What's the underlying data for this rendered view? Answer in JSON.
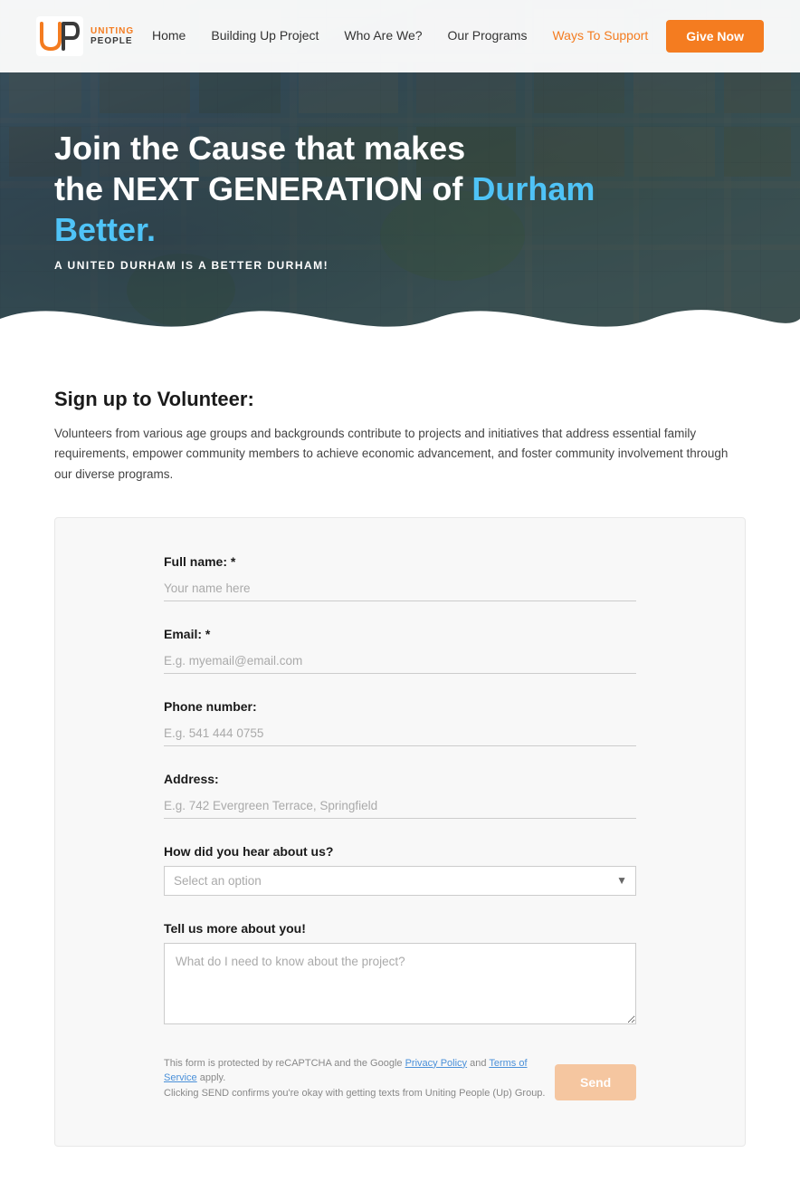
{
  "nav": {
    "logo_text": "UNITING PEOPLE",
    "links": [
      {
        "label": "Home",
        "active": false
      },
      {
        "label": "Building Up Project",
        "active": false
      },
      {
        "label": "Who Are We?",
        "active": false
      },
      {
        "label": "Our Programs",
        "active": false
      },
      {
        "label": "Ways To Support",
        "active": true
      }
    ],
    "cta_label": "Give Now"
  },
  "hero": {
    "title_line1": "Join the Cause that makes",
    "title_line2_plain": "the NEXT GENERATION of",
    "title_line2_highlight": "Durham Better.",
    "subtitle": "A United Durham is a Better Durham!"
  },
  "section": {
    "title": "Sign up to Volunteer:",
    "description": "Volunteers from various age groups and backgrounds contribute to projects and initiatives that address essential family requirements, empower community members to achieve economic advancement, and foster community involvement through our diverse programs."
  },
  "form": {
    "fullname_label": "Full name: *",
    "fullname_placeholder": "Your name here",
    "email_label": "Email: *",
    "email_placeholder": "E.g. myemail@email.com",
    "phone_label": "Phone number:",
    "phone_placeholder": "E.g. 541 444 0755",
    "address_label": "Address:",
    "address_placeholder": "E.g. 742 Evergreen Terrace, Springfield",
    "hear_label": "How did you hear about us?",
    "hear_placeholder": "Select an option",
    "tell_label": "Tell us more about you!",
    "tell_placeholder": "What do I need to know about the project?",
    "send_label": "Send"
  },
  "footer": {
    "recaptcha_text": "This form is protected by reCAPTCHA and the Google",
    "privacy_link": "Privacy Policy",
    "and_text": "and",
    "terms_link": "Terms of Service",
    "apply_text": "apply.",
    "send_confirm": "Clicking SEND confirms you're okay with getting texts from Uniting People (Up) Group."
  },
  "colors": {
    "orange": "#f47c20",
    "blue_highlight": "#4fc3f7",
    "send_disabled": "#f5c6a0"
  }
}
